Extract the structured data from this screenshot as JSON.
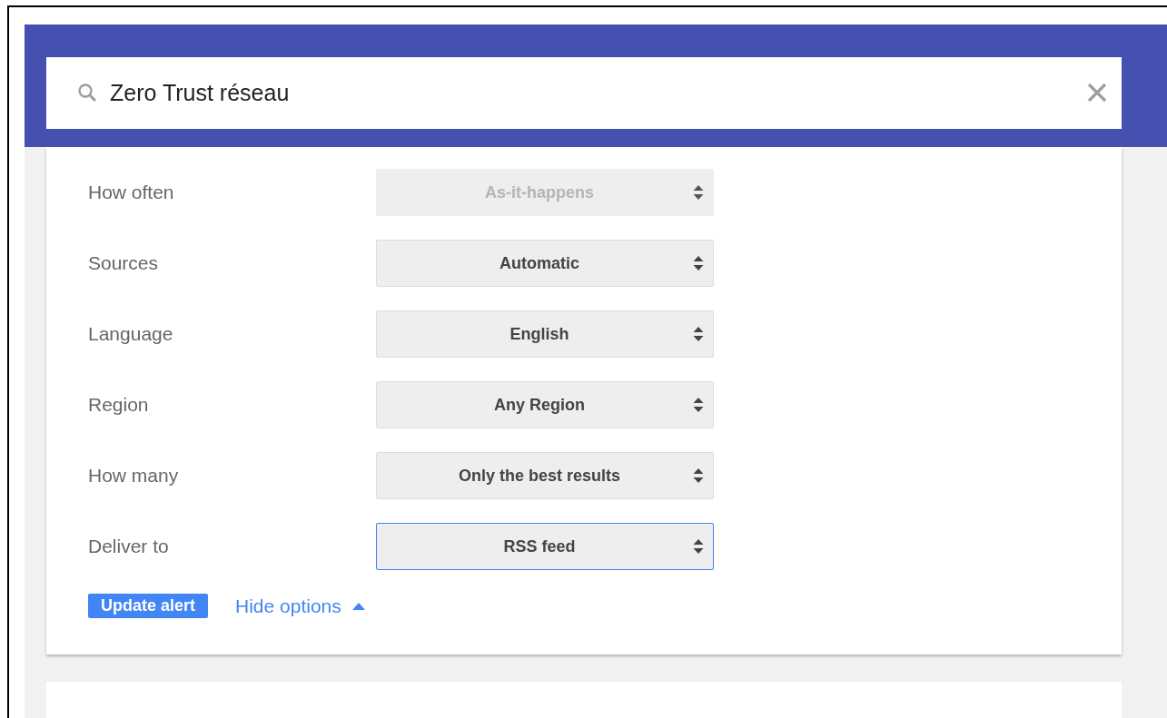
{
  "search": {
    "value": "Zero Trust réseau"
  },
  "options": [
    {
      "label": "How often",
      "value": "As-it-happens",
      "disabled": true,
      "focused": false
    },
    {
      "label": "Sources",
      "value": "Automatic",
      "disabled": false,
      "focused": false
    },
    {
      "label": "Language",
      "value": "English",
      "disabled": false,
      "focused": false
    },
    {
      "label": "Region",
      "value": "Any Region",
      "disabled": false,
      "focused": false
    },
    {
      "label": "How many",
      "value": "Only the best results",
      "disabled": false,
      "focused": false
    },
    {
      "label": "Deliver to",
      "value": "RSS feed",
      "disabled": false,
      "focused": true
    }
  ],
  "update_button": "Update alert",
  "toggle_link": "Hide options"
}
